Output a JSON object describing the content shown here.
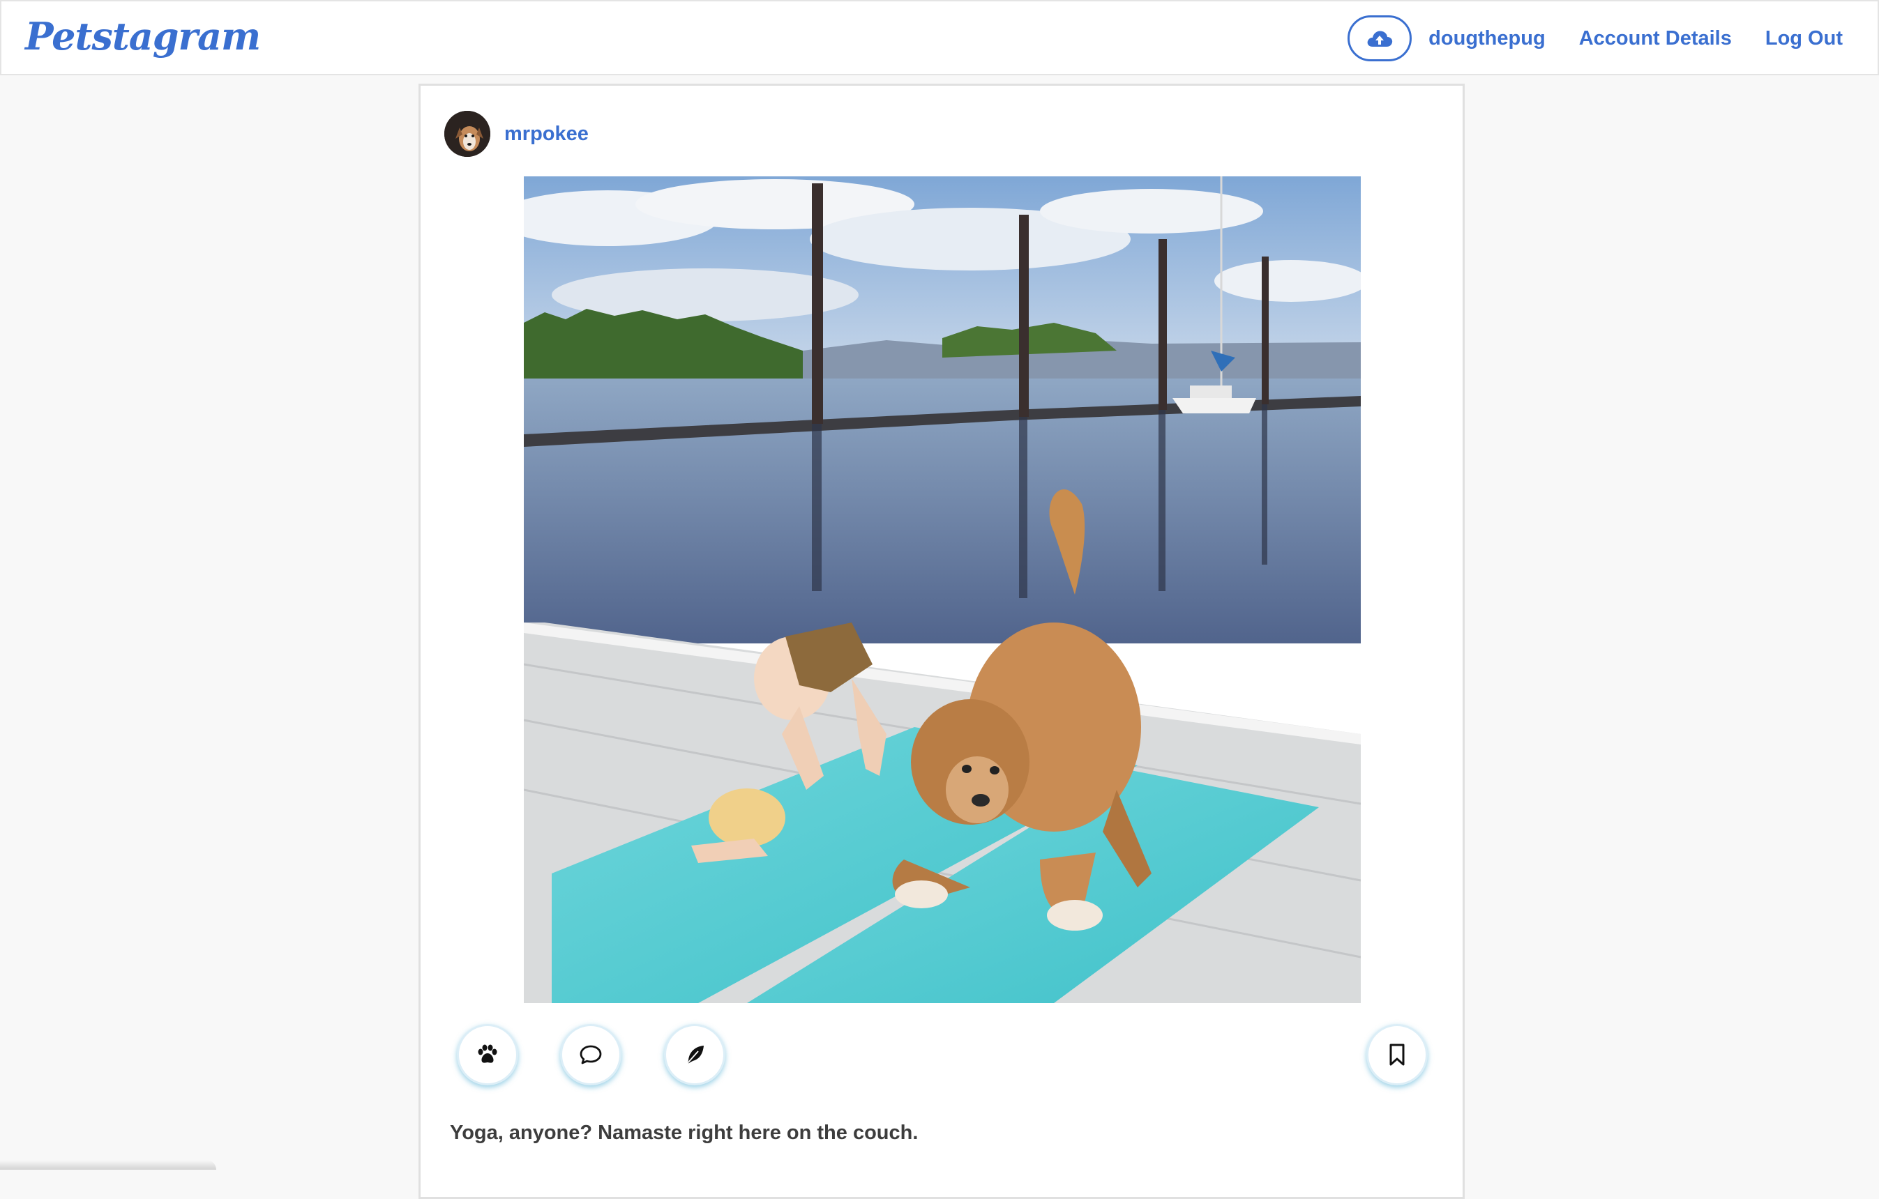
{
  "app": {
    "logo": "Petstagram"
  },
  "nav": {
    "upload_icon": "cloud-upload-icon",
    "username": "dougthepug",
    "account": "Account Details",
    "logout": "Log Out"
  },
  "post": {
    "author": "mrpokee",
    "caption": "Yoga, anyone? Namaste right here on the couch.",
    "actions": [
      {
        "icon": "paw-icon",
        "label": "like"
      },
      {
        "icon": "comment-icon",
        "label": "comment"
      },
      {
        "icon": "feather-icon",
        "label": "share"
      },
      {
        "icon": "bookmark-icon",
        "label": "save"
      }
    ]
  },
  "colors": {
    "accent": "#3a6fd0",
    "background": "#f8f8f8",
    "card": "#ffffff",
    "button_glow": "#46aad2"
  }
}
